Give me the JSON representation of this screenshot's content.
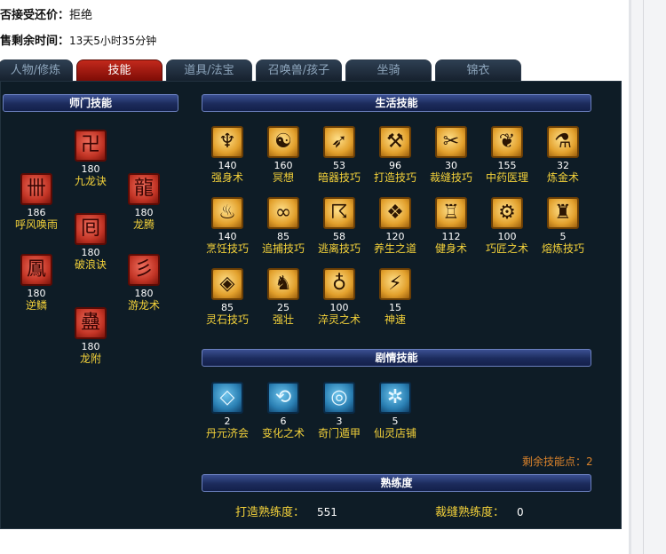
{
  "header": {
    "accept_label": "否接受还价：",
    "accept_value": "拒绝",
    "time_label": "售剩余时间：",
    "time_value": "13天5小时35分钟"
  },
  "tabs": [
    {
      "label": "人物/修炼",
      "active": false
    },
    {
      "label": "技能",
      "active": true
    },
    {
      "label": "道具/法宝",
      "active": false
    },
    {
      "label": "召唤兽/孩子",
      "active": false
    },
    {
      "label": "坐骑",
      "active": false
    },
    {
      "label": "锦衣",
      "active": false
    }
  ],
  "sections": {
    "school": "师门技能",
    "life": "生活技能",
    "story": "剧情技能",
    "proficiency": "熟练度"
  },
  "school_skills": [
    {
      "name": "九龙诀",
      "level": "180",
      "icon": "red-dragon-rune-icon",
      "glyph": "卍"
    },
    {
      "name": "呼风唤雨",
      "level": "186",
      "icon": "red-wind-rune-icon",
      "glyph": "卌"
    },
    {
      "name": "龙腾",
      "level": "180",
      "icon": "red-dragon-face-icon",
      "glyph": "龍"
    },
    {
      "name": "破浪诀",
      "level": "180",
      "icon": "red-wave-rune-icon",
      "glyph": "囘"
    },
    {
      "name": "逆鳞",
      "level": "180",
      "icon": "red-scale-rune-icon",
      "glyph": "鳳"
    },
    {
      "name": "游龙术",
      "level": "180",
      "icon": "red-swim-dragon-icon",
      "glyph": "彡"
    },
    {
      "name": "龙附",
      "level": "180",
      "icon": "red-dragon-attach-icon",
      "glyph": "蠱"
    }
  ],
  "life_skills": [
    {
      "name": "强身术",
      "level": "140",
      "icon": "strength-icon",
      "glyph": "♆"
    },
    {
      "name": "冥想",
      "level": "160",
      "icon": "meditation-icon",
      "glyph": "☯"
    },
    {
      "name": "暗器技巧",
      "level": "53",
      "icon": "dart-icon",
      "glyph": "➶"
    },
    {
      "name": "打造技巧",
      "level": "96",
      "icon": "hammer-icon",
      "glyph": "⚒"
    },
    {
      "name": "裁缝技巧",
      "level": "30",
      "icon": "scissors-icon",
      "glyph": "✂"
    },
    {
      "name": "中药医理",
      "level": "155",
      "icon": "herb-icon",
      "glyph": "❦"
    },
    {
      "name": "炼金术",
      "level": "32",
      "icon": "alchemy-icon",
      "glyph": "⚗"
    },
    {
      "name": "烹饪技巧",
      "level": "140",
      "icon": "cooking-icon",
      "glyph": "♨"
    },
    {
      "name": "追捕技巧",
      "level": "85",
      "icon": "chain-icon",
      "glyph": "∞"
    },
    {
      "name": "逃离技巧",
      "level": "58",
      "icon": "escape-icon",
      "glyph": "☈"
    },
    {
      "name": "养生之道",
      "level": "120",
      "icon": "health-icon",
      "glyph": "❖"
    },
    {
      "name": "健身术",
      "level": "112",
      "icon": "fitness-icon",
      "glyph": "♖"
    },
    {
      "name": "巧匠之术",
      "level": "100",
      "icon": "craftsman-icon",
      "glyph": "⚙"
    },
    {
      "name": "熔炼技巧",
      "level": "5",
      "icon": "smelting-icon",
      "glyph": "♜"
    },
    {
      "name": "灵石技巧",
      "level": "85",
      "icon": "gem-icon",
      "glyph": "◈"
    },
    {
      "name": "强壮",
      "level": "25",
      "icon": "muscle-icon",
      "glyph": "♞"
    },
    {
      "name": "淬灵之术",
      "level": "100",
      "icon": "tempering-icon",
      "glyph": "♁"
    },
    {
      "name": "神速",
      "level": "15",
      "icon": "speed-icon",
      "glyph": "⚡"
    }
  ],
  "story_skills": [
    {
      "name": "丹元济会",
      "level": "2",
      "icon": "elixir-icon",
      "glyph": "◇"
    },
    {
      "name": "变化之术",
      "level": "6",
      "icon": "transform-icon",
      "glyph": "⟲"
    },
    {
      "name": "奇门遁甲",
      "level": "3",
      "icon": "formation-icon",
      "glyph": "◎"
    },
    {
      "name": "仙灵店铺",
      "level": "5",
      "icon": "shop-icon",
      "glyph": "✲"
    }
  ],
  "remaining_points": "剩余技能点：2",
  "proficiency": [
    {
      "label": "打造熟练度：",
      "value": "551"
    },
    {
      "label": "裁缝熟练度：",
      "value": "0"
    }
  ],
  "colors": {
    "panel_bg": "#0e1c26",
    "skill_name": "#f4d23a",
    "active_tab": "#b3231a",
    "remaining": "#d9822b"
  }
}
